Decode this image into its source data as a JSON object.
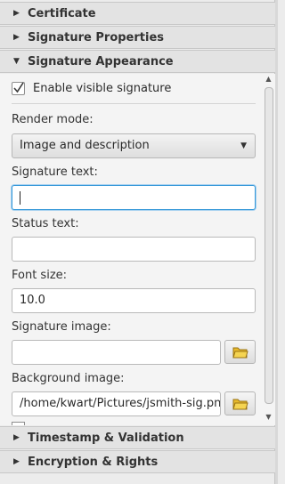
{
  "panels": {
    "certificate": "Certificate",
    "signature_properties": "Signature Properties",
    "signature_appearance": "Signature Appearance",
    "timestamp_validation": "Timestamp & Validation",
    "encryption_rights": "Encryption & Rights"
  },
  "appearance": {
    "enable_visible_label": "Enable visible signature",
    "enable_visible_checked": true,
    "render_mode_label": "Render mode:",
    "render_mode_value": "Image and description",
    "signature_text_label": "Signature text:",
    "signature_text_value": "",
    "status_text_label": "Status text:",
    "status_text_value": "",
    "font_size_label": "Font size:",
    "font_size_value": "10.0",
    "signature_image_label": "Signature image:",
    "signature_image_value": "",
    "background_image_label": "Background image:",
    "background_image_value": "/home/kwart/Pictures/jsmith-sig.pn"
  },
  "icons": {
    "collapsed": "triangle-right-icon",
    "expanded": "triangle-down-icon",
    "browse": "folder-icon",
    "check": "checkmark-icon"
  },
  "colors": {
    "focus_border": "#3a9ad9",
    "panel_header_bg": "#e3e3e3",
    "content_bg": "#f4f4f4"
  }
}
